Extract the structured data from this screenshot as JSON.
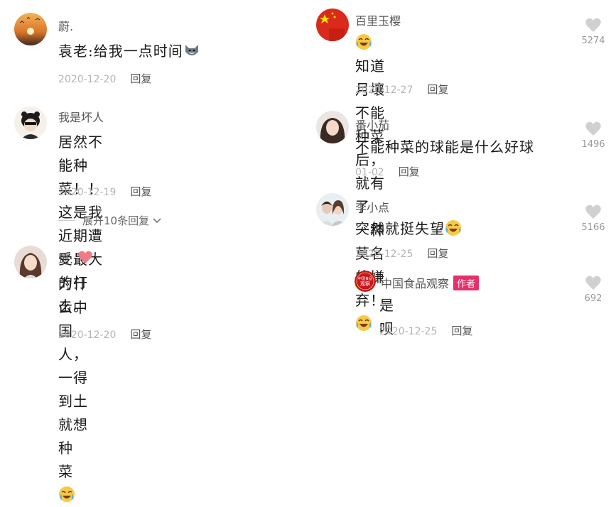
{
  "left": {
    "comments": [
      {
        "username": "蔚.",
        "text_parts": [
          "袁老:给我一点时间"
        ],
        "date": "2020-12-20",
        "reply_label": "回复",
        "emoji": "wolf-emoji"
      },
      {
        "username": "我是坏人",
        "text_line1": "居然不能种菜！！这是我近期遭",
        "text_line2": "受最大的打击。",
        "date": "2020-12-19",
        "reply_label": "回复",
        "expand_label": "展开10条回复"
      },
      {
        "username": "珂.",
        "text_line1": "为什么中国人，一得到土就想种",
        "text_line2": "菜",
        "date": "2020-12-20",
        "reply_label": "回复",
        "emoji": "crying-laugh-emoji"
      }
    ]
  },
  "right": {
    "comments": [
      {
        "username": "百里玉樱",
        "text_line1": "知道月壤不能种菜后，就有了",
        "text_line2": "一种莫名的嫌弃！",
        "date": "2020-12-27",
        "reply_label": "回复",
        "likes": "5274"
      },
      {
        "username": "番小茄",
        "text_line1": "不能种菜的球能是什么好球",
        "date": "01-02",
        "reply_label": "回复",
        "likes": "1496"
      },
      {
        "username": "李小点",
        "text_line1": "突然就挺失望",
        "date": "2020-12-25",
        "reply_label": "回复",
        "likes": "5166"
      },
      {
        "username": "中国食品观察",
        "author_tag": "作者",
        "text_line1": "是呗",
        "date": "2020-12-25",
        "reply_label": "回复",
        "likes": "692",
        "logo_text": "中国食品观察"
      }
    ]
  },
  "colors": {
    "author_tag": "#e4306b",
    "meta": "#b4b4b4",
    "heart": "#d0d0d0"
  }
}
